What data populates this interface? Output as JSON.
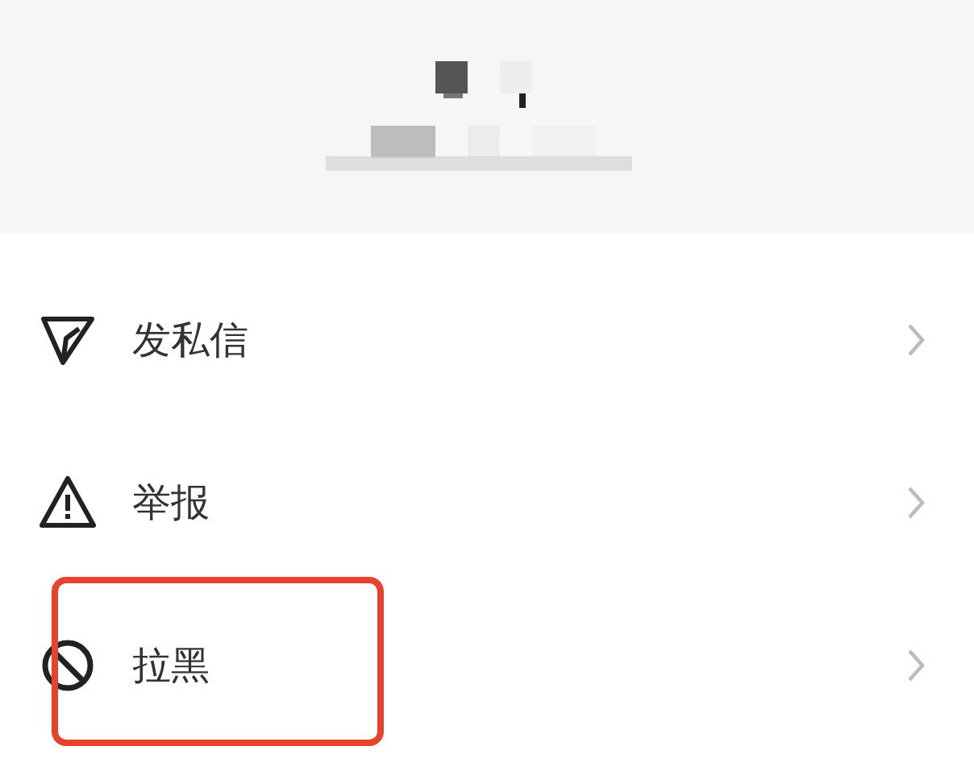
{
  "menu": [
    {
      "kind": "message",
      "label": "发私信",
      "highlighted": false
    },
    {
      "kind": "report",
      "label": "举报",
      "highlighted": false
    },
    {
      "kind": "block",
      "label": "拉黑",
      "highlighted": true
    }
  ]
}
